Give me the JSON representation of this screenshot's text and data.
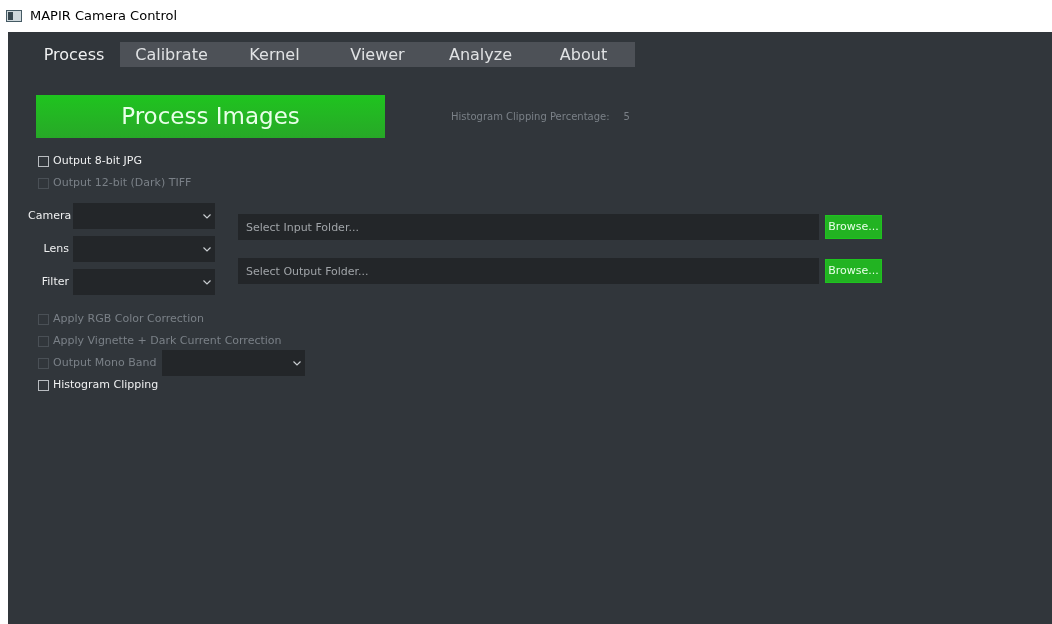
{
  "window": {
    "title": "MAPIR Camera Control"
  },
  "tabs": [
    {
      "label": "Process",
      "selected": true
    },
    {
      "label": "Calibrate",
      "selected": false
    },
    {
      "label": "Kernel",
      "selected": false
    },
    {
      "label": "Viewer",
      "selected": false
    },
    {
      "label": "Analyze",
      "selected": false
    },
    {
      "label": "About",
      "selected": false
    }
  ],
  "process_button": "Process Images",
  "histogram_percentage": {
    "label": "Histogram Clipping Percentage:",
    "value": "5",
    "disabled": true
  },
  "output_options": [
    {
      "label": "Output 8-bit JPG",
      "checked": false,
      "disabled": false
    },
    {
      "label": "Output 12-bit (Dark) TIFF",
      "checked": false,
      "disabled": true
    }
  ],
  "selectors": [
    {
      "label": "Camera"
    },
    {
      "label": "Lens"
    },
    {
      "label": "Filter"
    }
  ],
  "folders": [
    {
      "placeholder": "Select Input Folder...",
      "button": "Browse..."
    },
    {
      "placeholder": "Select Output Folder...",
      "button": "Browse..."
    }
  ],
  "corrections": [
    {
      "label": "Apply RGB Color Correction",
      "checked": false,
      "disabled": true,
      "kind": "checkbox"
    },
    {
      "label": "Apply Vignette + Dark Current Correction",
      "checked": false,
      "disabled": true,
      "kind": "checkbox"
    },
    {
      "label": "Output Mono Band",
      "checked": false,
      "disabled": true,
      "kind": "combo"
    },
    {
      "label": "Histogram Clipping",
      "checked": false,
      "disabled": false,
      "kind": "checkbox"
    }
  ]
}
